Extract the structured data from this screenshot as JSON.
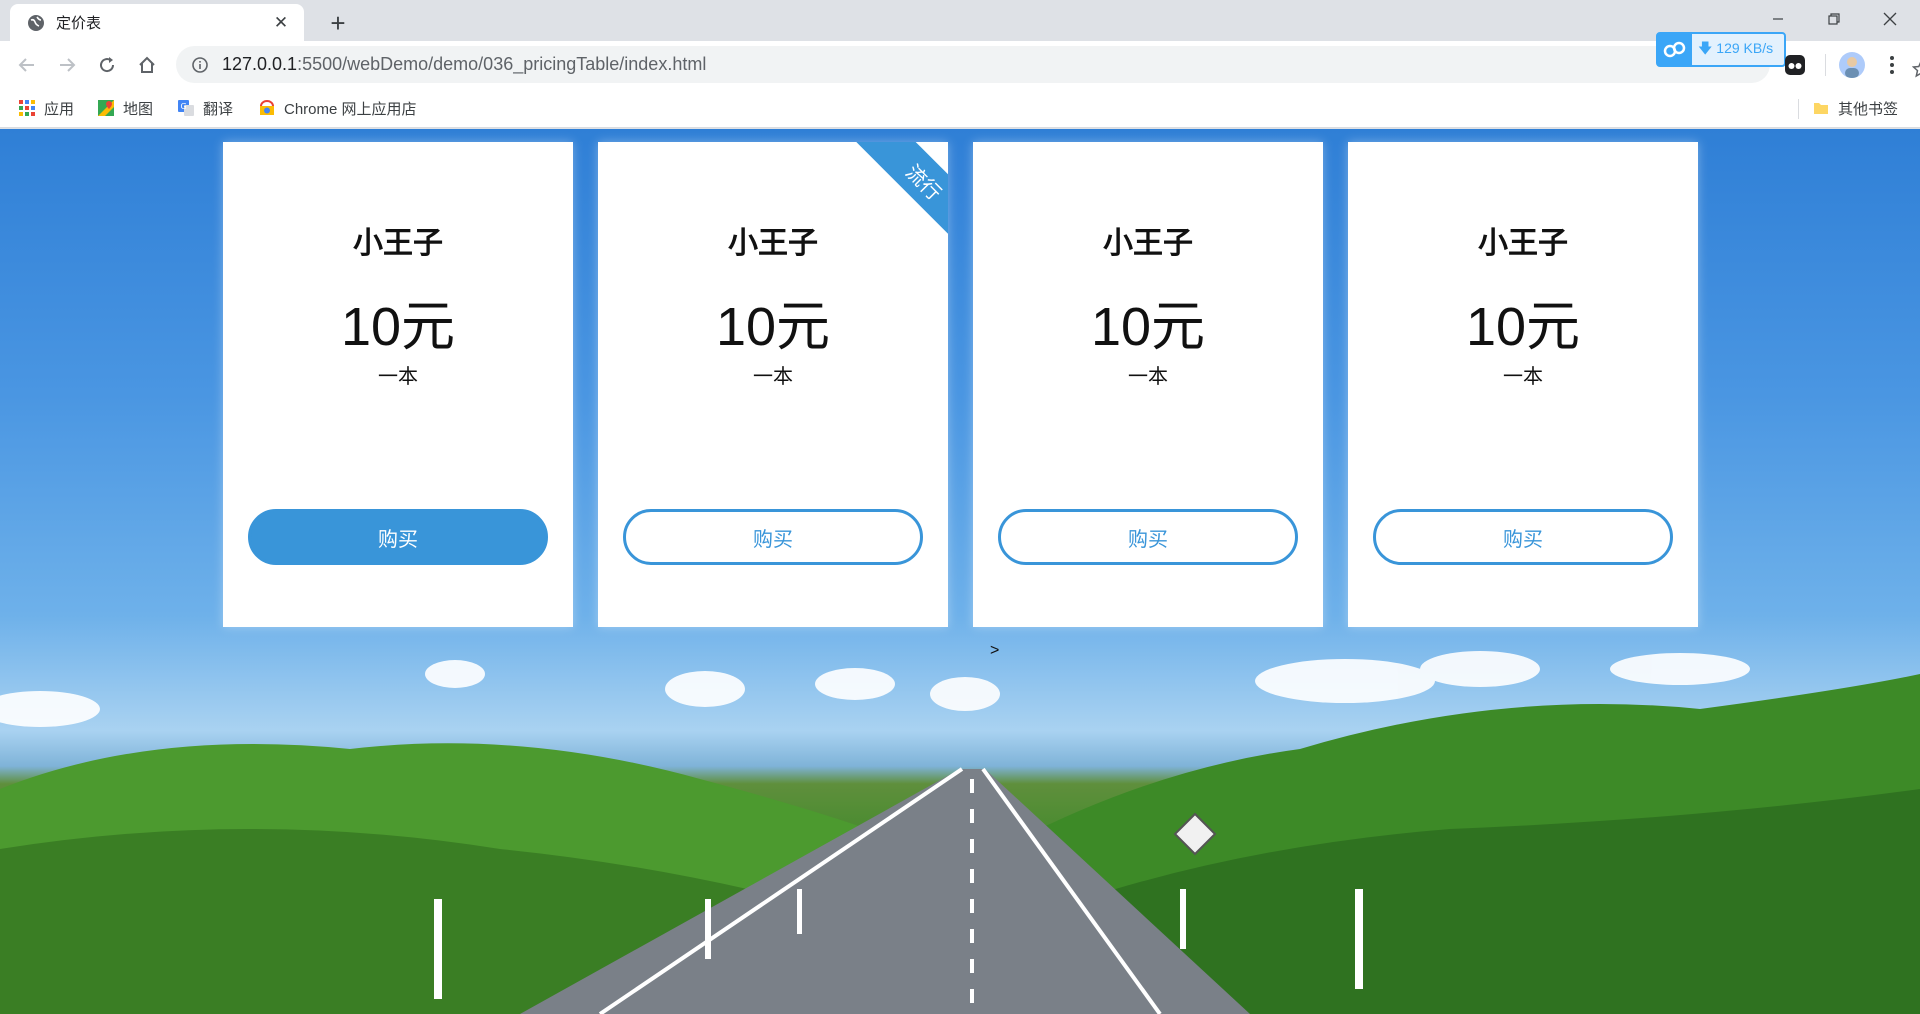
{
  "browser": {
    "tab_title": "定价表",
    "new_tab_glyph": "+",
    "url_host": "127.0.0.1",
    "url_path": ":5500/webDemo/demo/036_pricingTable/index.html",
    "extension_speed": "129 KB/s",
    "bookmarks": [
      {
        "label": "应用",
        "icon": "apps-grid-icon"
      },
      {
        "label": "地图",
        "icon": "maps-icon"
      },
      {
        "label": "翻译",
        "icon": "translate-icon"
      },
      {
        "label": "Chrome 网上应用店",
        "icon": "webstore-icon"
      }
    ],
    "other_bookmarks": "其他书签"
  },
  "page": {
    "cards": [
      {
        "title": "小王子",
        "price": "10元",
        "unit": "一本",
        "button": "购买",
        "featured": true
      },
      {
        "title": "小王子",
        "price": "10元",
        "unit": "一本",
        "button": "购买",
        "ribbon": "流行"
      },
      {
        "title": "小王子",
        "price": "10元",
        "unit": "一本",
        "button": "购买"
      },
      {
        "title": "小王子",
        "price": "10元",
        "unit": "一本",
        "button": "购买"
      }
    ],
    "stray_text": ">"
  },
  "colors": {
    "accent": "#3995d9",
    "chrome_bg": "#dee1e6"
  }
}
